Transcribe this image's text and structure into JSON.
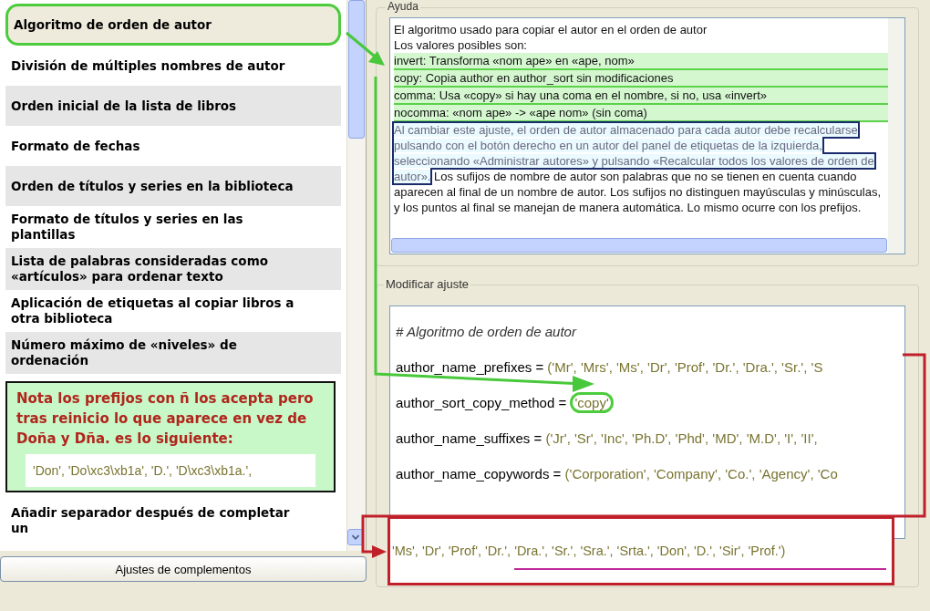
{
  "sidebar": {
    "items": [
      {
        "label": "Algoritmo de orden de autor",
        "selected": true
      },
      {
        "label": "División de múltiples nombres de autor",
        "selected": false
      },
      {
        "label": "Orden inicial de la lista de libros",
        "selected": false
      },
      {
        "label": "Formato de fechas",
        "selected": false
      },
      {
        "label": "Orden de títulos y series en la biblioteca",
        "selected": false
      },
      {
        "label": "Formato de títulos y series en las plantillas",
        "selected": false
      },
      {
        "label": "Lista de palabras consideradas como «artículos» para ordenar texto",
        "selected": false
      },
      {
        "label": "Aplicación de etiquetas al copiar libros a otra biblioteca",
        "selected": false
      },
      {
        "label": "Número máximo de «niveles» de ordenación",
        "selected": false
      },
      {
        "label": "Añadir separador después de completar un",
        "selected": false
      }
    ],
    "button": "Ajustes de complementos"
  },
  "help": {
    "title": "Ayuda",
    "segments": [
      {
        "kind": "line",
        "text": "El algoritmo usado para copiar el autor en el orden de autor"
      },
      {
        "kind": "line",
        "text": "Los valores posibles son:"
      },
      {
        "kind": "option",
        "text": "invert: Transforma «nom ape» en «ape, nom»"
      },
      {
        "kind": "option",
        "text": "copy: Copia author en author_sort sin modificaciones"
      },
      {
        "kind": "option",
        "text": "comma: Usa «copy» si hay una coma en el nombre, si no, usa «invert»"
      },
      {
        "kind": "option",
        "text": "nocomma: «nom ape» -> «ape nom» (sin coma)"
      },
      {
        "kind": "note",
        "text": "Al cambiar este ajuste, el orden de autor almacenado para cada autor debe recalcularse pulsando con el botón derecho en un autor del panel de etiquetas de la izquierda, seleccionando «Administrar autores» y pulsando «Recalcular todos los valores de orden de autor»."
      },
      {
        "kind": "text",
        "text": "Los sufijos de nombre de autor son palabras que no se tienen en cuenta cuando aparecen al final de un nombre de autor. Los sufijos no distinguen mayúsculas y minúsculas, y los puntos al final se manejan de manera automática. Lo mismo ocurre con los prefijos."
      }
    ]
  },
  "editor": {
    "title": "Modificar ajuste",
    "lines": [
      {
        "kind": "comment",
        "text": "# Algoritmo de orden de autor"
      },
      {
        "kind": "assign",
        "name": "author_name_prefixes = ",
        "value": "('Mr', 'Mrs', 'Ms', 'Dr', 'Prof', 'Dr.', 'Dra.', 'Sr.', 'S",
        "circled": false
      },
      {
        "kind": "assign",
        "name": "author_sort_copy_method = ",
        "value": "'copy'",
        "circled": true
      },
      {
        "kind": "assign",
        "name": "author_name_suffixes = ",
        "value": "('Jr', 'Sr', 'Inc', 'Ph.D', 'Phd', 'MD', 'M.D', 'I', 'II',",
        "circled": false
      },
      {
        "kind": "assign",
        "name": "author_name_copywords = ",
        "value": "('Corporation', 'Company', 'Co.', 'Agency', 'Co",
        "circled": false
      }
    ]
  },
  "annotations": {
    "note": {
      "lines": [
        "Nota los prefijos con ñ los acepta pero",
        "tras reinicio lo que aparece en vez de",
        "Doña y Dña. es lo siguiente:"
      ],
      "code": "'Don', 'Do\\xc3\\xb1a', 'D.', 'D\\xc3\\xb1a.',"
    },
    "callout": {
      "text": "'Ms', 'Dr', 'Prof', 'Dr.', 'Dra.', 'Sr.', 'Sra.', 'Srta.', 'Don', 'D.', 'Sir', 'Prof.')"
    }
  }
}
